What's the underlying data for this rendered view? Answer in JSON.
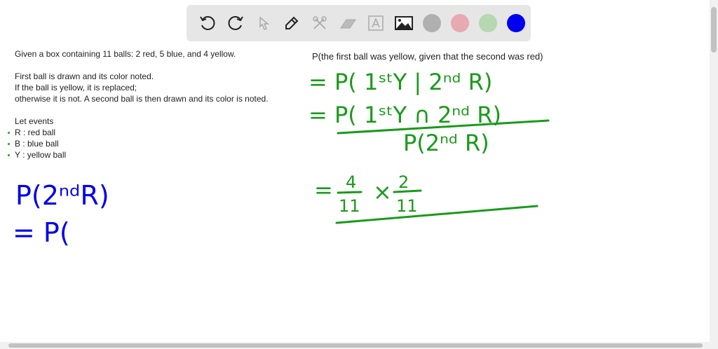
{
  "toolbar": {
    "tools": [
      "undo-icon",
      "redo-icon",
      "pointer-icon",
      "pen-icon",
      "tools-icon",
      "eraser-icon",
      "text-icon",
      "image-icon"
    ],
    "colors": [
      "#b0b0b0",
      "#e8a9b0",
      "#b5d8b0",
      "#0000ee"
    ]
  },
  "problem": {
    "line1": "Given a box containing 11 balls: 2 red, 5 blue, and 4 yellow.",
    "line2": "First ball is drawn and its color noted.",
    "line3": "If the ball is yellow, it is replaced;",
    "line4": "otherwise it is not. A second ball is then drawn and its color is noted.",
    "events_label": "Let events",
    "events": [
      "R : red ball",
      "B : blue ball",
      "Y : yellow ball"
    ]
  },
  "question": "P(the first ball was yellow, given that the second was red)",
  "ink": {
    "blue_color": "#0000ee",
    "green_color": "#1a9a1a",
    "blue1": "P(2ⁿᵈR)",
    "blue2": "= P(",
    "green1": "= P( 1ˢᵗY | 2ⁿᵈ R)",
    "green2": "= P( 1ˢᵗY ∩ 2ⁿᵈ R)",
    "green3": "P(2ⁿᵈ R)",
    "green4a": "=",
    "frac1_num": "4",
    "frac1_den": "11",
    "times": "×",
    "frac2_num": "2",
    "frac2_den": "11"
  }
}
